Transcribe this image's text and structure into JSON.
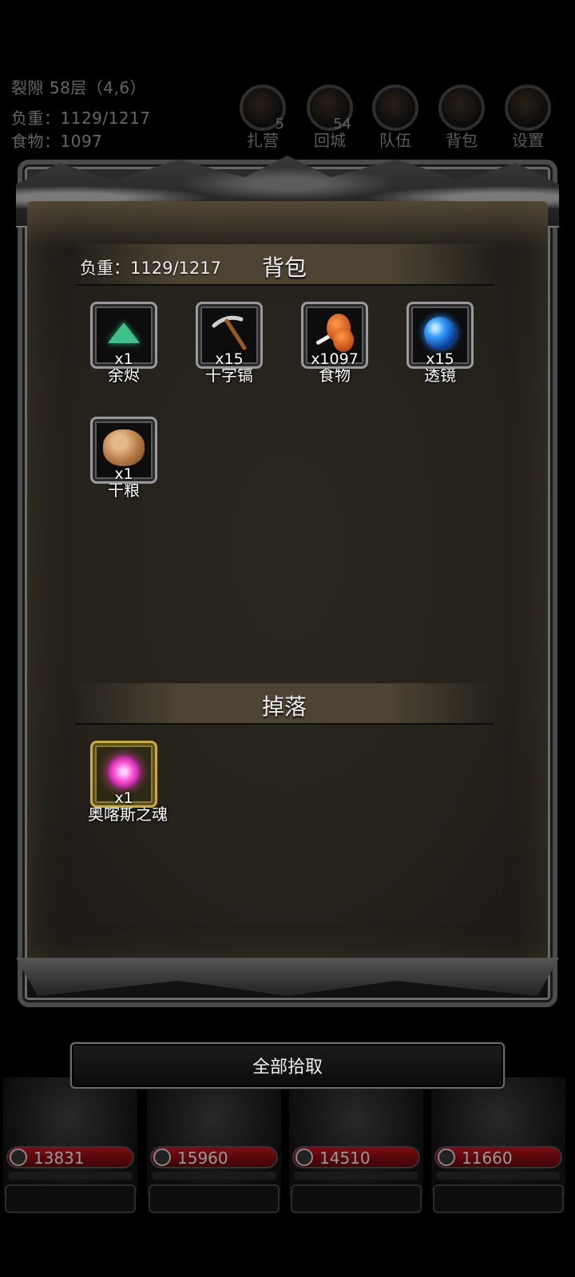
{
  "hud": {
    "location": "裂隙 58层（4,6）",
    "load": "负重：1129/1217",
    "food": "食物：1097",
    "buttons": [
      {
        "label": "扎营",
        "badge": "5",
        "icon": "camp-icon"
      },
      {
        "label": "回城",
        "badge": "54",
        "icon": "portal-icon"
      },
      {
        "label": "队伍",
        "badge": "",
        "icon": "team-icon"
      },
      {
        "label": "背包",
        "badge": "",
        "icon": "backpack-icon"
      },
      {
        "label": "设置",
        "badge": "",
        "icon": "gear-icon"
      }
    ]
  },
  "backpack": {
    "title": "背包",
    "weight": "负重：1129/1217",
    "items": [
      {
        "name": "余烬",
        "count": "x1",
        "icon": "ember-icon"
      },
      {
        "name": "十字镐",
        "count": "x15",
        "icon": "pickaxe-icon"
      },
      {
        "name": "食物",
        "count": "x1097",
        "icon": "food-icon"
      },
      {
        "name": "透镜",
        "count": "x15",
        "icon": "lens-icon"
      },
      {
        "name": "干粮",
        "count": "x1",
        "icon": "ration-icon"
      }
    ]
  },
  "drops": {
    "title": "掉落",
    "items": [
      {
        "name": "奥喀斯之魂",
        "count": "x1",
        "icon": "soul-icon"
      }
    ]
  },
  "actions": {
    "pickup_all": "全部拾取"
  },
  "party": [
    {
      "hp": "13831"
    },
    {
      "hp": "15960"
    },
    {
      "hp": "14510"
    },
    {
      "hp": "11660"
    }
  ]
}
